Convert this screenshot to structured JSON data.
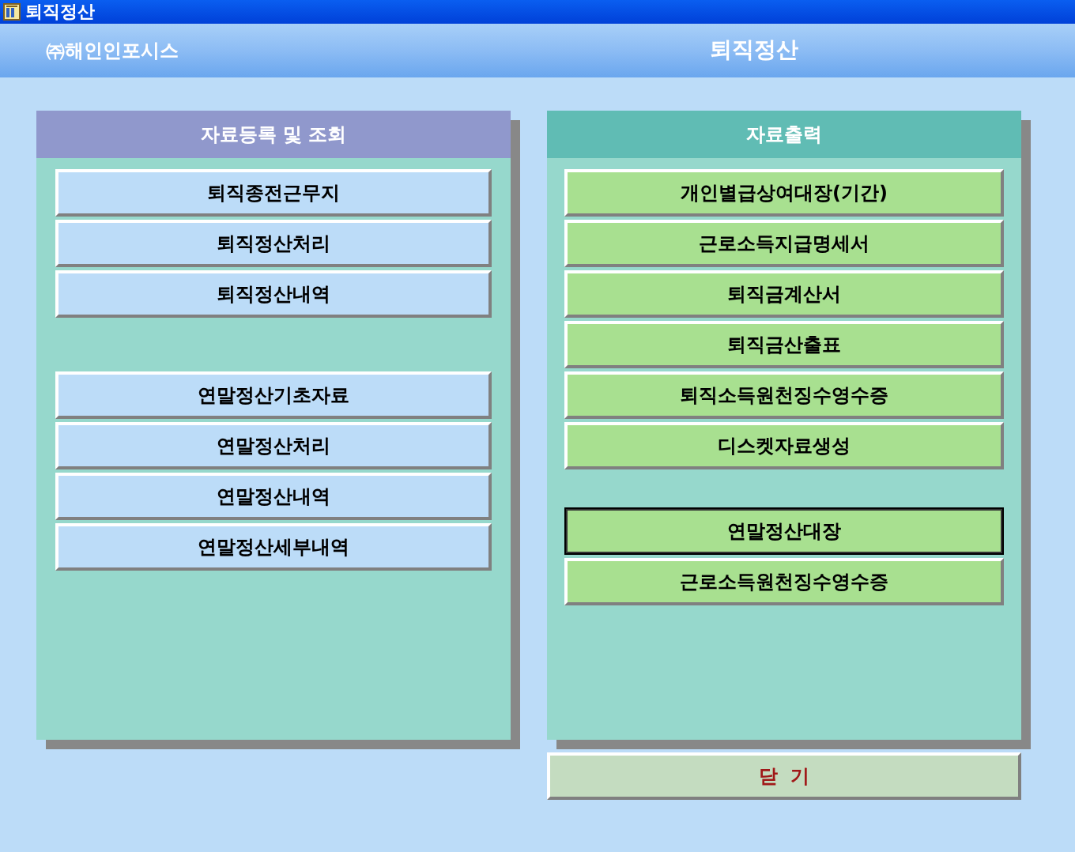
{
  "window": {
    "title": "퇴직정산"
  },
  "header": {
    "company": "㈜해인인포시스",
    "title": "퇴직정산"
  },
  "panels": [
    {
      "kind": "input",
      "title": "자료등록 및 조회",
      "groups": [
        [
          {
            "label": "퇴직종전근무지",
            "focused": false
          },
          {
            "label": "퇴직정산처리",
            "focused": false
          },
          {
            "label": "퇴직정산내역",
            "focused": false
          }
        ],
        [
          {
            "label": "연말정산기초자료",
            "focused": false
          },
          {
            "label": "연말정산처리",
            "focused": false
          },
          {
            "label": "연말정산내역",
            "focused": false
          },
          {
            "label": "연말정산세부내역",
            "focused": false
          }
        ]
      ]
    },
    {
      "kind": "output",
      "title": "자료출력",
      "groups": [
        [
          {
            "label": "개인별급상여대장(기간)",
            "focused": false
          },
          {
            "label": "근로소득지급명세서",
            "focused": false
          },
          {
            "label": "퇴직금계산서",
            "focused": false
          },
          {
            "label": "퇴직금산출표",
            "focused": false
          },
          {
            "label": "퇴직소득원천징수영수증",
            "focused": false
          },
          {
            "label": "디스켓자료생성",
            "focused": false
          }
        ],
        [
          {
            "label": "연말정산대장",
            "focused": true
          },
          {
            "label": "근로소득원천징수영수증",
            "focused": false
          }
        ]
      ]
    }
  ],
  "close_button": "닫  기"
}
